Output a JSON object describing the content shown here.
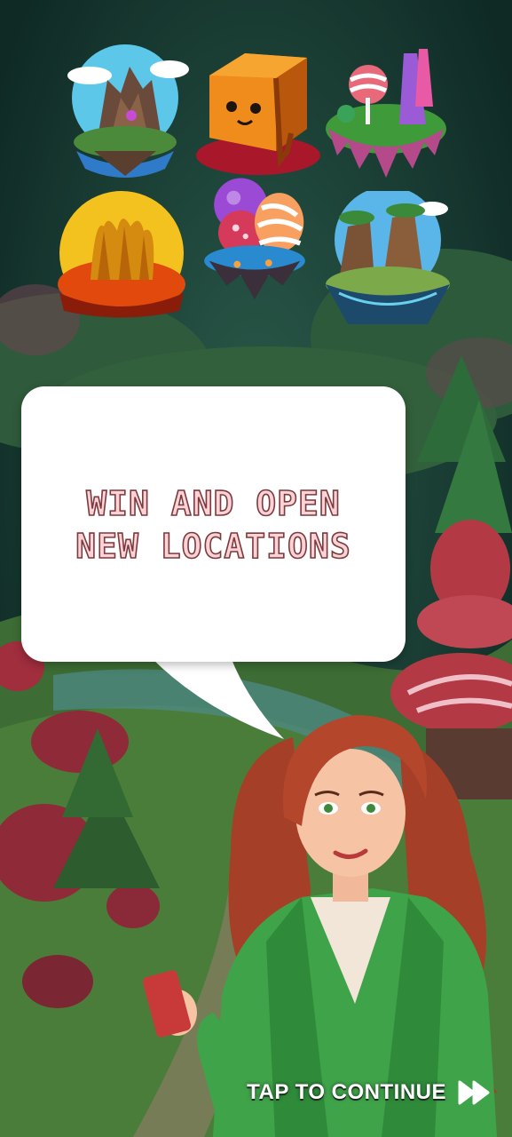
{
  "screen": {
    "message_line_1": "WIN AND OPEN",
    "message_line_2": "NEW LOCATIONS",
    "tap_label": "TAP TO CONTINUE"
  },
  "locations": [
    {
      "icon": "rock-island-icon"
    },
    {
      "icon": "caramel-cube-icon"
    },
    {
      "icon": "candy-island-icon"
    },
    {
      "icon": "lava-rocks-icon"
    },
    {
      "icon": "candy-balls-island-icon"
    },
    {
      "icon": "jungle-island-icon"
    }
  ],
  "colors": {
    "message_fill": "#ffd2d6",
    "message_stroke": "#7a3b3f",
    "bubble": "#ffffff",
    "jacket": "#3fa34a",
    "hair": "#b4472b"
  }
}
